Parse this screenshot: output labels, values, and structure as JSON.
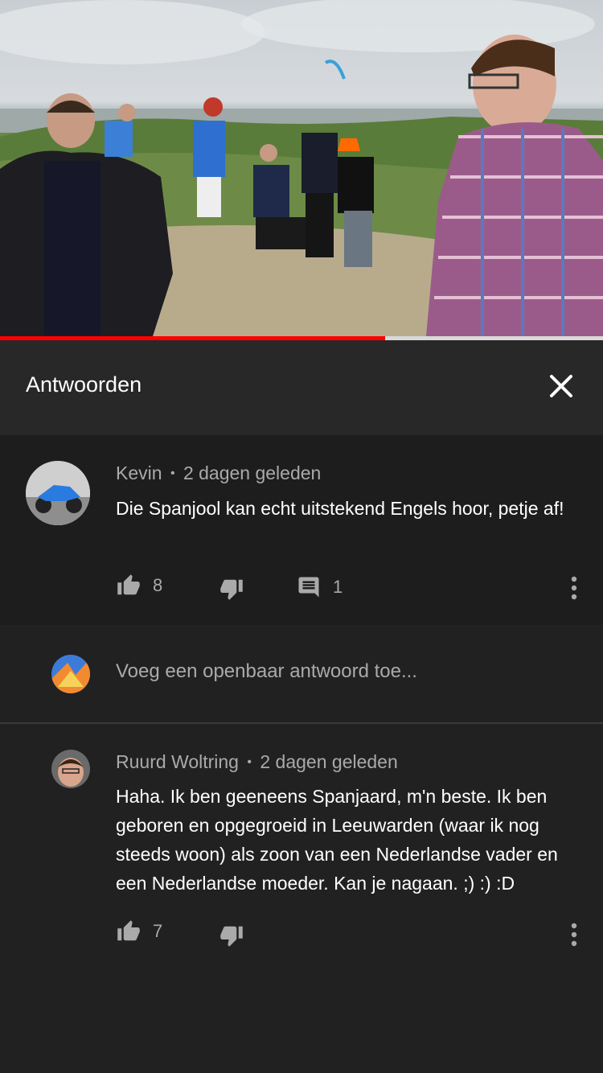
{
  "video": {
    "progress_fraction": 0.638
  },
  "header": {
    "title": "Antwoorden",
    "close_icon": "close-icon"
  },
  "main_comment": {
    "author": "Kevin",
    "separator": "•",
    "time": "2 dagen geleden",
    "text": "Die Spanjool kan echt uitstekend Engels hoor, petje af!",
    "likes": "8",
    "replies": "1",
    "icons": [
      "thumbs-up-icon",
      "thumbs-down-icon",
      "reply-icon",
      "more-vert-icon"
    ]
  },
  "reply_input": {
    "placeholder": "Voeg een openbaar antwoord toe..."
  },
  "reply_comment": {
    "author": "Ruurd Woltring",
    "separator": "•",
    "time": "2 dagen geleden",
    "text": "Haha. Ik ben geeneens Spanjaard, m'n beste. Ik ben geboren en opgegroeid in Leeuwarden (waar ik nog steeds woon) als zoon van een Nederlandse vader en een Nederlandse moeder. Kan je nagaan. ;) :) :D",
    "likes": "7",
    "icons": [
      "thumbs-up-icon",
      "thumbs-down-icon",
      "more-vert-icon"
    ]
  },
  "colors": {
    "background": "#212121",
    "header_bg": "#282828",
    "main_comment_bg": "#1d1d1d",
    "progress": "#ff0000",
    "secondary_text": "#aaaaaa"
  }
}
